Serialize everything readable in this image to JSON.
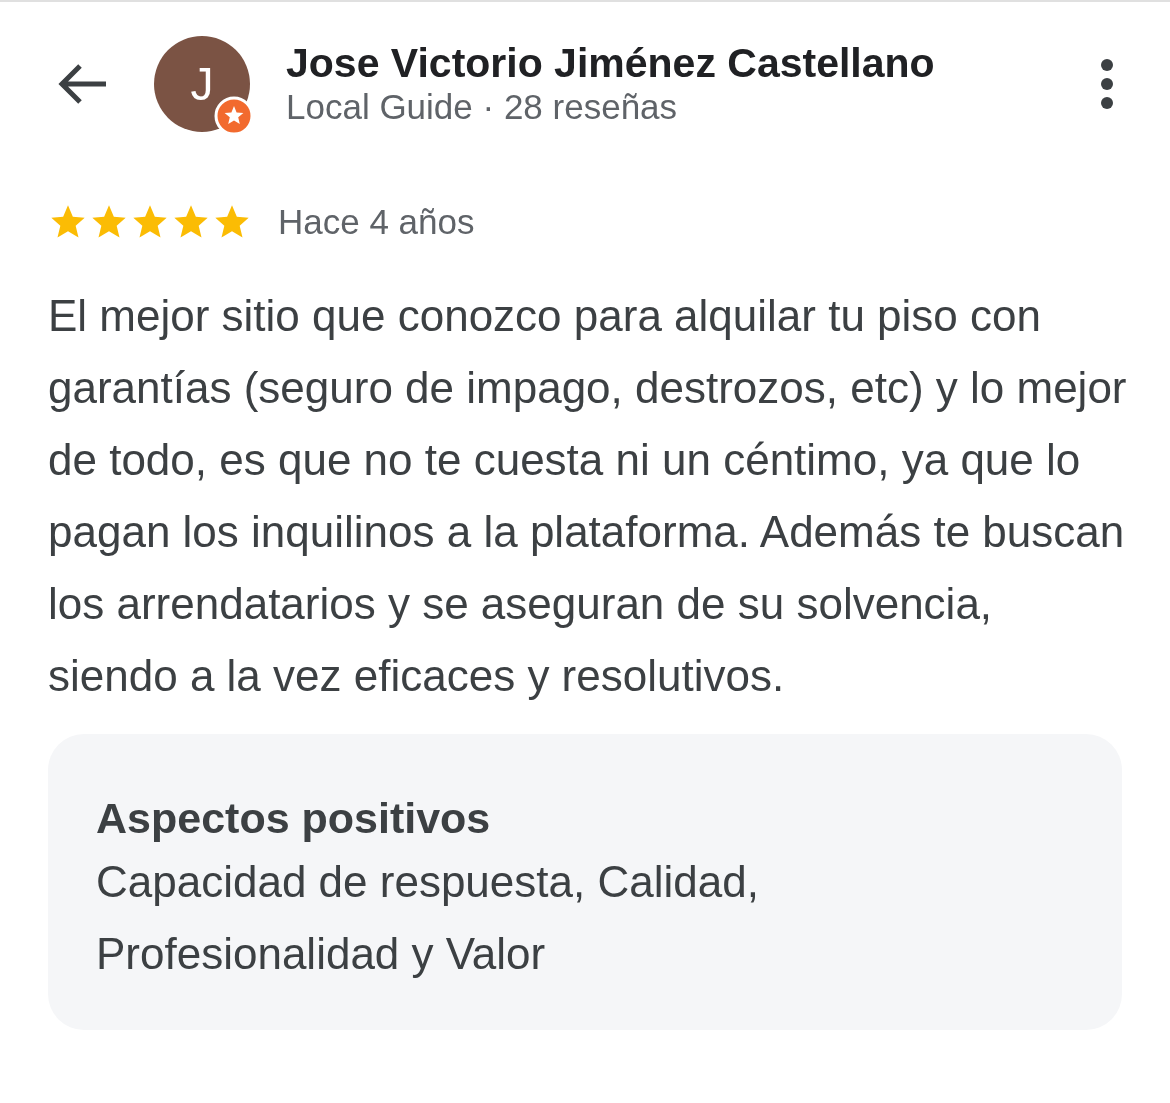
{
  "header": {
    "avatar_letter": "J",
    "name": "Jose Victorio Jiménez Castellano",
    "subtitle": "Local Guide · 28 reseñas"
  },
  "review": {
    "stars": 5,
    "time": "Hace 4 años",
    "text": "El mejor sitio que conozco para alquilar tu piso con garantías (seguro de impago, destrozos, etc) y lo mejor de todo, es que no te cuesta ni un céntimo, ya que lo pagan los inquilinos a la plataforma. Además te buscan los arrendatarios y se aseguran de su solvencia, siendo a la vez eficaces y resolutivos."
  },
  "highlights": {
    "title": "Aspectos positivos",
    "text": "Capacidad de respuesta, Calidad, Profesionalidad y Valor"
  }
}
